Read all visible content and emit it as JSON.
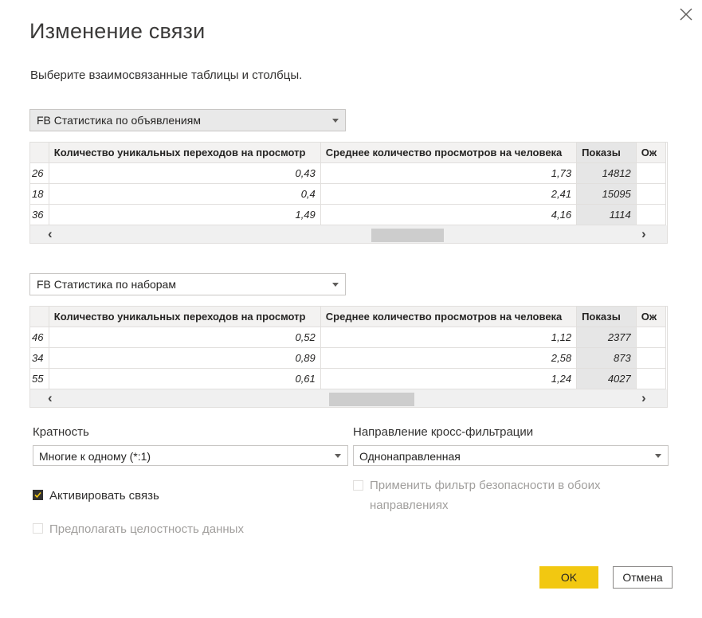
{
  "dialog": {
    "title": "Изменение связи",
    "subtitle": "Выберите взаимосвязанные таблицы и столбцы."
  },
  "table1": {
    "selected": "FB Статистика по объявлениям",
    "columns": [
      "Количество уникальных переходов на просмотр",
      "Среднее количество просмотров на человека",
      "Показы",
      "Ож"
    ],
    "rows": [
      [
        "26",
        "0,43",
        "1,73",
        "14812"
      ],
      [
        "18",
        "0,4",
        "2,41",
        "15095"
      ],
      [
        "36",
        "1,49",
        "4,16",
        "1114"
      ]
    ]
  },
  "table2": {
    "selected": "FB Статистика по наборам",
    "columns": [
      "Количество уникальных переходов на просмотр",
      "Среднее количество просмотров на человека",
      "Показы",
      "Ож"
    ],
    "rows": [
      [
        "46",
        "0,52",
        "1,12",
        "2377"
      ],
      [
        "34",
        "0,89",
        "2,58",
        "873"
      ],
      [
        "55",
        "0,61",
        "1,24",
        "4027"
      ]
    ]
  },
  "cardinality": {
    "label": "Кратность",
    "value": "Многие к одному (*:1)"
  },
  "cross_filter": {
    "label": "Направление кросс-фильтрации",
    "value": "Однонаправленная"
  },
  "options": {
    "activate": "Активировать связь",
    "integrity": "Предполагать целостность данных",
    "security_line1": "Применить фильтр безопасности в обоих",
    "security_line2": "направлениях"
  },
  "buttons": {
    "ok": "OK",
    "cancel": "Отмена"
  },
  "icons": {
    "close": "close-icon",
    "scroll_left": "‹",
    "scroll_right": "›"
  },
  "colors": {
    "accent": "#f2c811",
    "selected_column": "#e6e6e6"
  }
}
